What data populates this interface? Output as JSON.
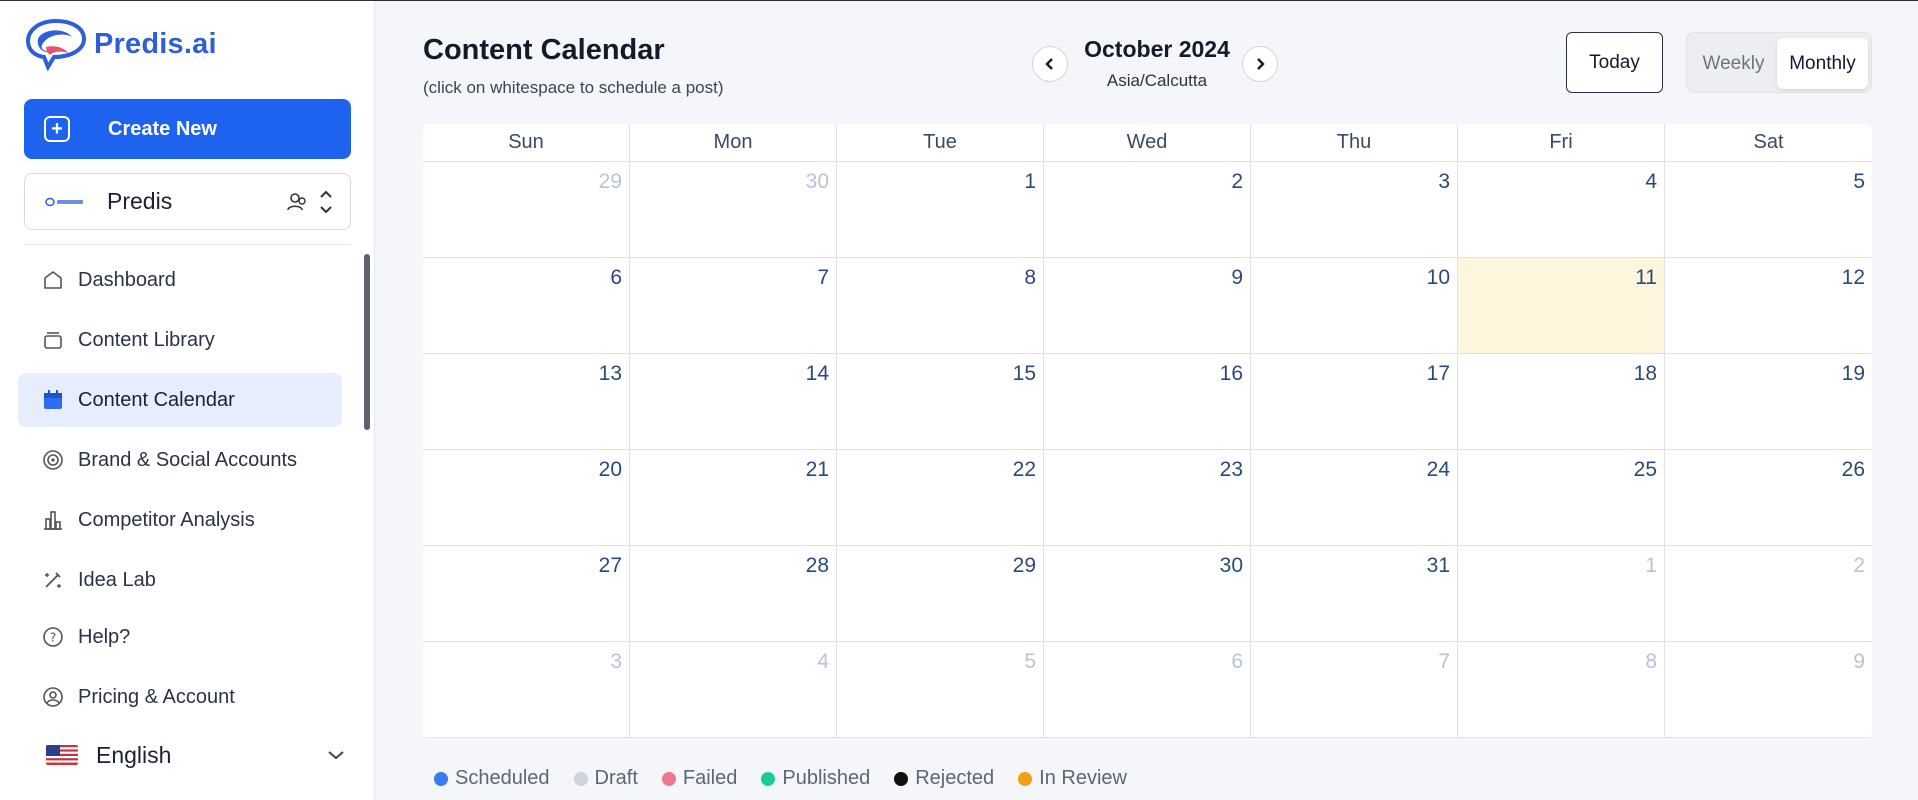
{
  "sidebar": {
    "logo_text": "Predis.ai",
    "create_label": "Create New",
    "brand_name": "Predis",
    "nav": [
      {
        "label": "Dashboard",
        "icon": "home-icon"
      },
      {
        "label": "Content Library",
        "icon": "library-icon"
      },
      {
        "label": "Content Calendar",
        "icon": "calendar-icon",
        "active": true
      },
      {
        "label": "Brand & Social Accounts",
        "icon": "accounts-icon"
      },
      {
        "label": "Competitor Analysis",
        "icon": "chart-icon"
      },
      {
        "label": "Idea Lab",
        "icon": "idea-lab-icon"
      },
      {
        "label": "Help?",
        "icon": "help-icon"
      },
      {
        "label": "Pricing & Account",
        "icon": "account-icon"
      }
    ],
    "language": "English"
  },
  "header": {
    "title": "Content Calendar",
    "subtitle": "(click on whitespace to schedule a post)",
    "month": "October 2024",
    "timezone": "Asia/Calcutta",
    "today_label": "Today",
    "view_weekly": "Weekly",
    "view_monthly": "Monthly",
    "active_view": "Monthly"
  },
  "calendar": {
    "weekdays": [
      "Sun",
      "Mon",
      "Tue",
      "Wed",
      "Thu",
      "Fri",
      "Sat"
    ],
    "weeks": [
      [
        "29",
        "30",
        "1",
        "2",
        "3",
        "4",
        "5"
      ],
      [
        "6",
        "7",
        "8",
        "9",
        "10",
        "11",
        "12"
      ],
      [
        "13",
        "14",
        "15",
        "16",
        "17",
        "18",
        "19"
      ],
      [
        "20",
        "21",
        "22",
        "23",
        "24",
        "25",
        "26"
      ],
      [
        "27",
        "28",
        "29",
        "30",
        "31",
        "1",
        "2"
      ],
      [
        "3",
        "4",
        "5",
        "6",
        "7",
        "8",
        "9"
      ]
    ],
    "today": "11"
  },
  "legend": [
    {
      "label": "Scheduled",
      "color": "#3b7bf0"
    },
    {
      "label": "Draft",
      "color": "#d0d3dc"
    },
    {
      "label": "Failed",
      "color": "#f0788c"
    },
    {
      "label": "Published",
      "color": "#1cc99a"
    },
    {
      "label": "Rejected",
      "color": "#111111"
    },
    {
      "label": "In Review",
      "color": "#f0a012"
    }
  ]
}
